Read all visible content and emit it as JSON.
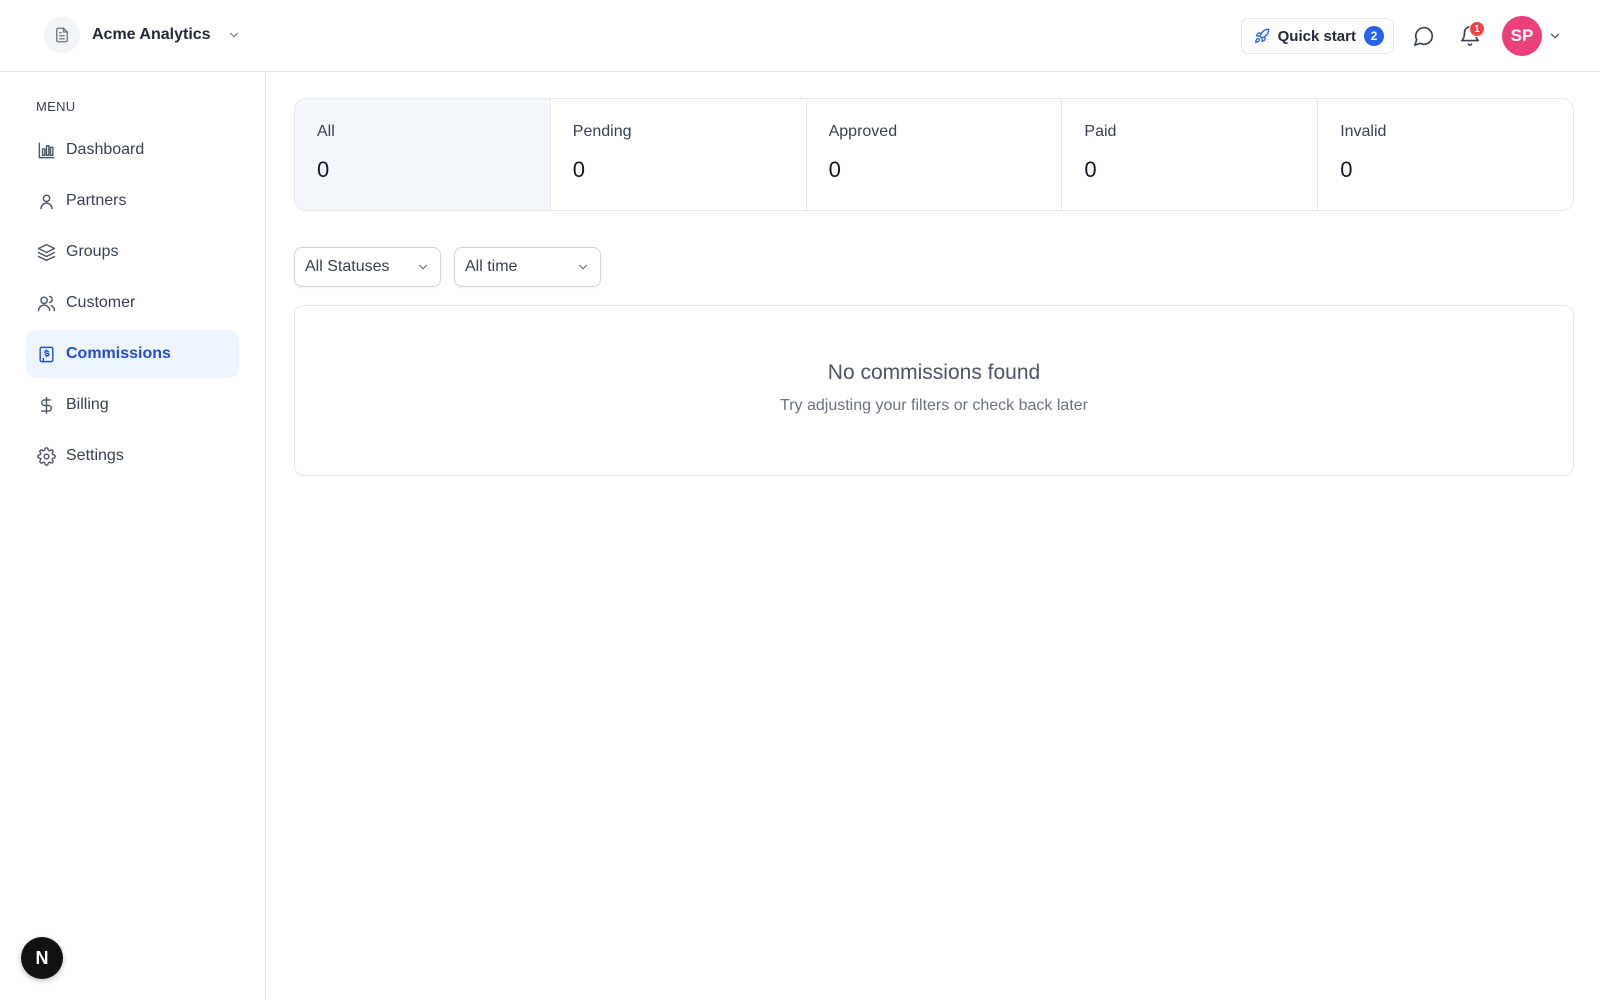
{
  "header": {
    "org_name": "Acme Analytics",
    "quick_start_label": "Quick start",
    "quick_start_count": "2",
    "notification_count": "1",
    "avatar_initials": "SP",
    "accent_color": "#2563eb",
    "avatar_color": "#ec407a"
  },
  "sidebar": {
    "menu_label": "MENU",
    "items": [
      {
        "label": "Dashboard",
        "icon": "bar-chart-icon"
      },
      {
        "label": "Partners",
        "icon": "user-icon"
      },
      {
        "label": "Groups",
        "icon": "layers-icon"
      },
      {
        "label": "Customer",
        "icon": "users-icon"
      },
      {
        "label": "Commissions",
        "icon": "commission-icon",
        "active": true
      },
      {
        "label": "Billing",
        "icon": "dollar-icon"
      },
      {
        "label": "Settings",
        "icon": "gear-icon"
      }
    ],
    "next_badge": "N"
  },
  "stats": [
    {
      "label": "All",
      "value": "0",
      "active": true
    },
    {
      "label": "Pending",
      "value": "0"
    },
    {
      "label": "Approved",
      "value": "0"
    },
    {
      "label": "Paid",
      "value": "0"
    },
    {
      "label": "Invalid",
      "value": "0"
    }
  ],
  "filters": {
    "status": "All Statuses",
    "time": "All time"
  },
  "empty_state": {
    "title": "No commissions found",
    "subtitle": "Try adjusting your filters or check back later"
  }
}
